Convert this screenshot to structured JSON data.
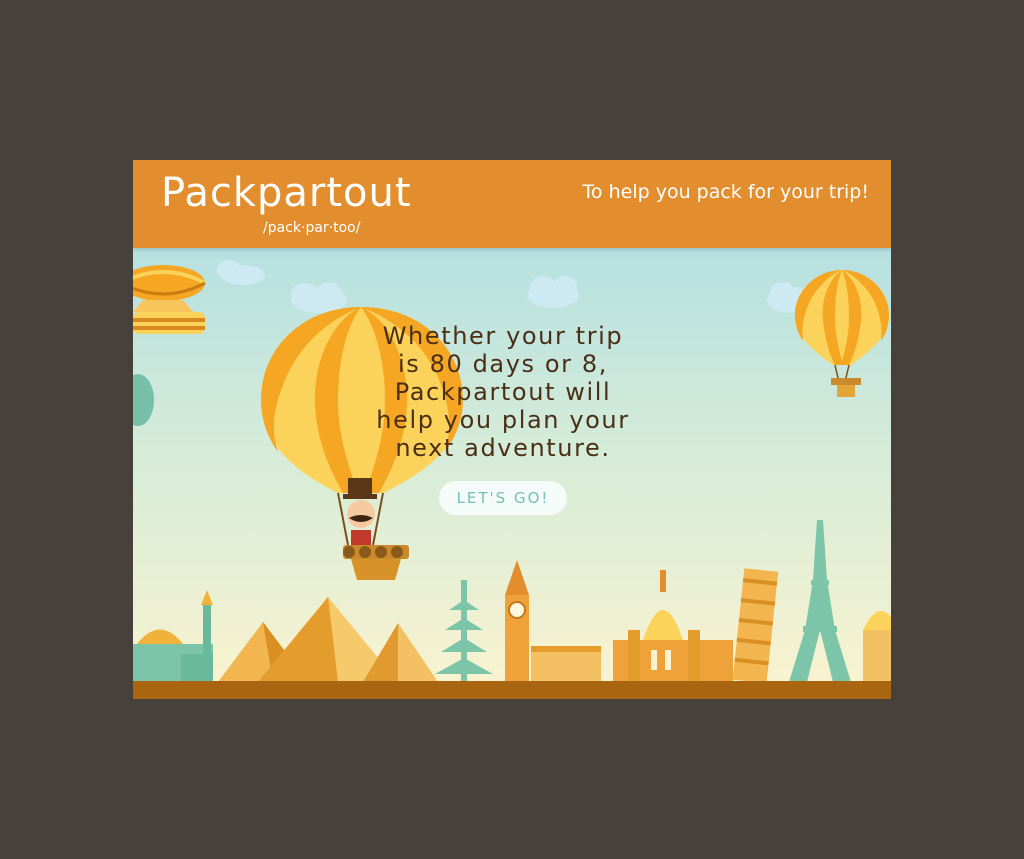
{
  "header": {
    "brand": "Packpartout",
    "pronunciation": "/pack·par·too/",
    "tagline": "To help you pack for your trip!"
  },
  "hero": {
    "message_lines": [
      "Whether your trip",
      "is 80 days or 8,",
      "Packpartout will",
      "help you plan your",
      "next adventure."
    ],
    "cta_label": "LET'S GO!"
  },
  "colors": {
    "page_background": "#48403b",
    "header": "#e28e2e",
    "ground": "#a9650f",
    "sky_top": "#a8dbe4",
    "sky_bottom": "#fbf3cf",
    "balloon_orange": "#f5a623",
    "balloon_yellow": "#fbd35a",
    "teal": "#6cc0a8",
    "cta_text": "#72c2b2"
  },
  "icons": [
    "hot-air-balloon-icon",
    "airship-icon",
    "pyramid-icon",
    "big-ben-icon",
    "leaning-tower-icon",
    "eiffel-tower-icon",
    "cloud-icon"
  ]
}
